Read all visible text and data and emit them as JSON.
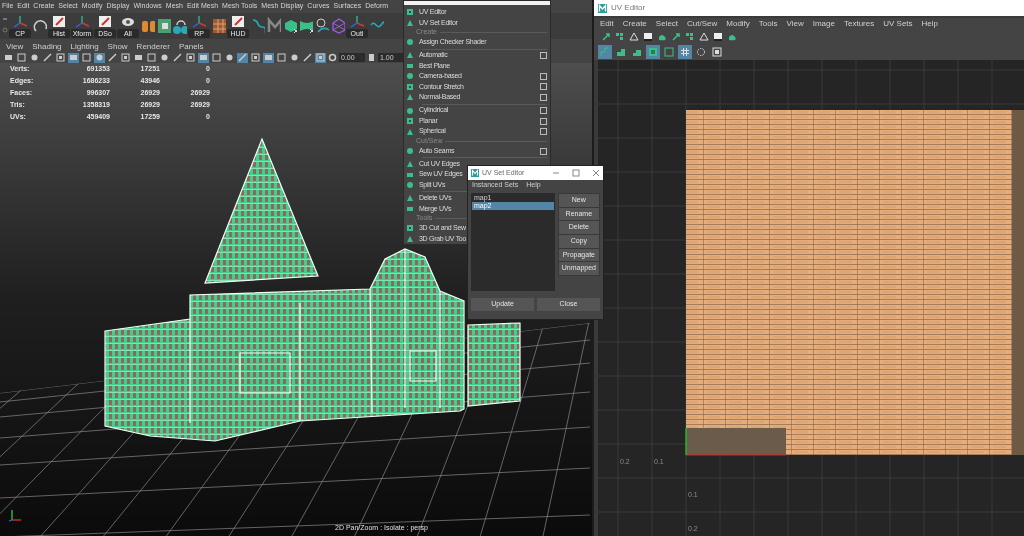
{
  "main_menu": [
    "File",
    "Edit",
    "Create",
    "Select",
    "Modify",
    "Display",
    "Windows",
    "Mesh",
    "Edit Mesh",
    "Mesh Tools",
    "Mesh Display",
    "Curves",
    "Surfaces",
    "Deform"
  ],
  "shelf": [
    {
      "kind": "labeled",
      "label": "CP"
    },
    {
      "kind": "plain"
    },
    {
      "kind": "labeled",
      "label": "Hist"
    },
    {
      "kind": "labeled",
      "label": "Xform"
    },
    {
      "kind": "labeled",
      "label": "DSo"
    },
    {
      "kind": "labeled",
      "label": "All"
    },
    {
      "kind": "plain"
    },
    {
      "kind": "plain"
    },
    {
      "kind": "plain"
    },
    {
      "kind": "labeled",
      "label": "RP"
    },
    {
      "kind": "plain"
    },
    {
      "kind": "labeled",
      "label": "HUD"
    },
    {
      "kind": "plain"
    },
    {
      "kind": "plain"
    },
    {
      "kind": "plain"
    },
    {
      "kind": "plain"
    },
    {
      "kind": "plain"
    },
    {
      "kind": "plain"
    },
    {
      "kind": "labeled",
      "label": "Outl"
    },
    {
      "kind": "plain"
    }
  ],
  "panel_menu": [
    "View",
    "Shading",
    "Lighting",
    "Show",
    "Renderer",
    "Panels"
  ],
  "panel_toolbar": {
    "toggles": [
      {
        "on": false
      },
      {
        "on": false
      },
      {
        "on": false
      },
      {
        "on": false
      },
      {
        "on": false
      },
      {
        "on": true
      },
      {
        "on": false
      },
      {
        "on": true
      },
      {
        "on": false
      },
      {
        "on": false
      },
      {
        "on": false
      },
      {
        "on": false
      },
      {
        "on": false
      },
      {
        "on": false
      },
      {
        "on": false
      },
      {
        "on": true
      },
      {
        "on": false
      },
      {
        "on": false
      },
      {
        "on": true
      },
      {
        "on": false
      },
      {
        "on": true
      },
      {
        "on": false
      },
      {
        "on": false
      },
      {
        "on": false
      },
      {
        "on": true
      }
    ],
    "fields": [
      "0.00",
      "1.00"
    ]
  },
  "stats": [
    {
      "label": "Verts:",
      "values": [
        "691353",
        "17251",
        "0"
      ]
    },
    {
      "label": "Edges:",
      "values": [
        "1686233",
        "43946",
        "0"
      ]
    },
    {
      "label": "Faces:",
      "values": [
        "996307",
        "26929",
        "26929"
      ]
    },
    {
      "label": "Tris:",
      "values": [
        "1358319",
        "26929",
        "26929"
      ]
    },
    {
      "label": "UVs:",
      "values": [
        "459409",
        "17259",
        "0"
      ]
    }
  ],
  "viewport_status": "2D Pan/Zoom : Isolate : persp",
  "uv_menu": [
    {
      "kind": "item",
      "label": "UV Editor",
      "option_box": false
    },
    {
      "kind": "item",
      "label": "UV Set Editor",
      "option_box": false
    },
    {
      "kind": "section",
      "label": "Create"
    },
    {
      "kind": "item",
      "label": "Assign Checker Shader",
      "option_box": false
    },
    {
      "kind": "divider"
    },
    {
      "kind": "item",
      "label": "Automatic",
      "option_box": true
    },
    {
      "kind": "item",
      "label": "Best Plane",
      "option_box": false
    },
    {
      "kind": "item",
      "label": "Camera-based",
      "option_box": true
    },
    {
      "kind": "item",
      "label": "Contour Stretch",
      "option_box": true
    },
    {
      "kind": "item",
      "label": "Normal-Based",
      "option_box": true
    },
    {
      "kind": "divider"
    },
    {
      "kind": "item",
      "label": "Cylindrical",
      "option_box": true
    },
    {
      "kind": "item",
      "label": "Planar",
      "option_box": true
    },
    {
      "kind": "item",
      "label": "Spherical",
      "option_box": true
    },
    {
      "kind": "section",
      "label": "Cut/Sew"
    },
    {
      "kind": "item",
      "label": "Auto Seams",
      "option_box": true
    },
    {
      "kind": "divider"
    },
    {
      "kind": "item",
      "label": "Cut UV Edges",
      "option_box": false
    },
    {
      "kind": "item",
      "label": "Sew UV Edges",
      "option_box": false
    },
    {
      "kind": "item",
      "label": "Split UVs",
      "option_box": false
    },
    {
      "kind": "divider"
    },
    {
      "kind": "item",
      "label": "Delete UVs",
      "option_box": false
    },
    {
      "kind": "item",
      "label": "Merge UVs",
      "option_box": false
    },
    {
      "kind": "section",
      "label": "Tools"
    },
    {
      "kind": "item",
      "label": "3D Cut and Sew",
      "option_box": false
    },
    {
      "kind": "item",
      "label": "3D Grab UV Too",
      "option_box": false
    }
  ],
  "uv_set_editor": {
    "title": "UV Set Editor",
    "menu": [
      "Instanced Sets",
      "Help"
    ],
    "sets": [
      {
        "label": "map1",
        "selected": false
      },
      {
        "label": "map2",
        "selected": true
      }
    ],
    "side_buttons": [
      "New",
      "Rename",
      "Delete",
      "Copy",
      "Propagate",
      "Unmapped"
    ],
    "bottom_buttons": [
      "Update",
      "Close"
    ]
  },
  "uv_editor": {
    "title": "UV Editor",
    "menu": [
      "Edit",
      "Create",
      "Select",
      "Cut/Sew",
      "Modify",
      "Tools",
      "View",
      "Image",
      "Textures",
      "UV Sets",
      "Help"
    ],
    "toolbar_1": [
      {
        "on": false
      },
      {
        "on": false
      },
      {
        "on": false
      },
      {
        "on": false
      },
      {
        "on": false
      },
      {
        "on": false
      },
      {
        "on": false
      },
      {
        "on": false
      },
      {
        "on": false
      },
      {
        "on": false
      }
    ],
    "toolbar_2": [
      {
        "on": true
      },
      {
        "on": false
      },
      {
        "on": false
      },
      {
        "on": true
      },
      {
        "on": false
      },
      {
        "on": true
      },
      {
        "on": false
      },
      {
        "on": false
      }
    ],
    "axis_labels": [
      {
        "kind": "u",
        "label": "0.2"
      },
      {
        "kind": "u",
        "label": "0.1"
      },
      {
        "kind": "v",
        "label": "0.1"
      },
      {
        "kind": "v",
        "label": "0.2"
      }
    ]
  }
}
